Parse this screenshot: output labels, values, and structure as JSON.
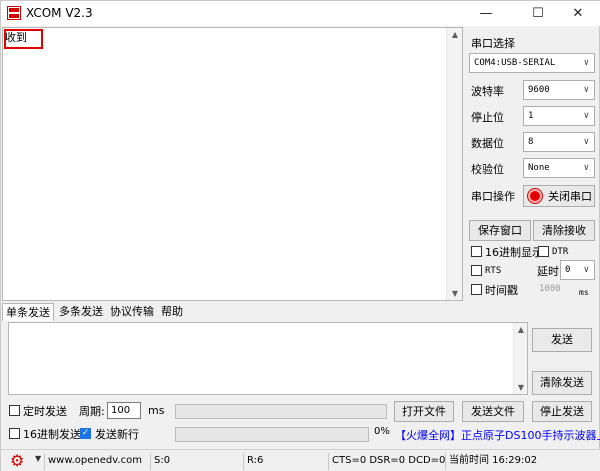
{
  "window": {
    "title": "XCOM V2.3"
  },
  "receive": {
    "text": "收到"
  },
  "panel": {
    "port_select_label": "串口选择",
    "port_value": "COM4:USB-SERIAL",
    "baud_label": "波特率",
    "baud_value": "9600",
    "stopbits_label": "停止位",
    "stopbits_value": "1",
    "databits_label": "数据位",
    "databits_value": "8",
    "parity_label": "校验位",
    "parity_value": "None",
    "port_op_label": "串口操作",
    "close_port_label": "关闭串口",
    "save_window_label": "保存窗口",
    "clear_receive_label": "清除接收",
    "hex_display_label": "16进制显示",
    "dtr_label": "DTR",
    "rts_label": "RTS",
    "delay_label": "延时",
    "delay_value": "0",
    "timestamp_label": "时间戳",
    "timestamp_value": "1000",
    "timestamp_unit": "ms"
  },
  "tabs": [
    {
      "label": "单条发送"
    },
    {
      "label": "多条发送"
    },
    {
      "label": "协议传输"
    },
    {
      "label": "帮助"
    }
  ],
  "send": {
    "send_label": "发送",
    "clear_send_label": "清除发送",
    "timed_send_label": "定时发送",
    "period_label": "周期:",
    "period_value": "100",
    "period_unit": "ms",
    "open_file_label": "打开文件",
    "send_file_label": "发送文件",
    "stop_send_label": "停止发送",
    "hex_send_label": "16进制发送",
    "send_newline_label": "发送新行",
    "progress_text": "0%",
    "progress_value": 0,
    "promo_link": "【火爆全网】正点原子DS100手持示波器上市"
  },
  "statusbar": {
    "url": "www.openedv.com",
    "sent": "S:0",
    "received": "R:6",
    "signals": "CTS=0 DSR=0 DCD=0",
    "time": "当前时间 16:29:02"
  },
  "colors": {
    "accent_red": "#e00000",
    "link_blue": "#0000ff",
    "check_blue": "#1a73e8"
  }
}
